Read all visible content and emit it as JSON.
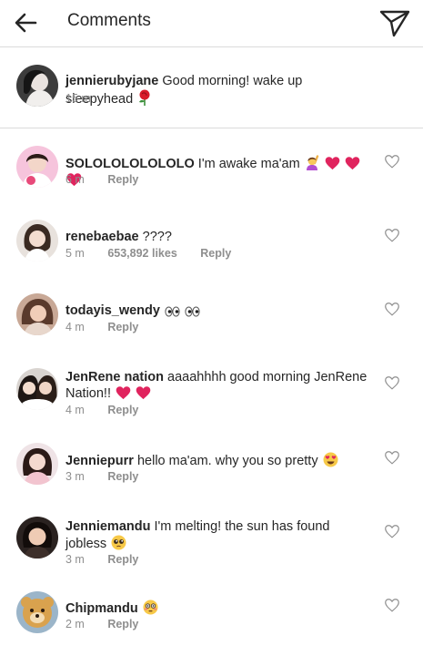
{
  "header": {
    "title": "Comments",
    "back_icon": "arrow-left-icon",
    "send_icon": "paper-plane-icon"
  },
  "caption": {
    "username": "jennierubyjane",
    "text": "Good morning! wake up sleepyhead",
    "emoji": "rose-icon",
    "time": "15 m"
  },
  "comments": [
    {
      "username": "SOLOLOLOLOLOLO",
      "text": "I'm awake ma'am",
      "emojis": [
        "raising-hand-woman-icon",
        "red-heart-icon",
        "red-heart-icon",
        "red-heart-icon"
      ],
      "time": "6 m",
      "reply": "Reply"
    },
    {
      "username": "renebaebae",
      "text": "????",
      "time": "5 m",
      "likes": "653,892 likes",
      "reply": "Reply"
    },
    {
      "username": "todayis_wendy",
      "text": "",
      "emojis": [
        "eyes-icon",
        "eyes-icon"
      ],
      "time": "4 m",
      "reply": "Reply"
    },
    {
      "username": "JenRene nation",
      "text": "aaaahhhh good morning JenRene Nation!!",
      "emojis": [
        "red-heart-icon",
        "red-heart-icon"
      ],
      "time": "4 m",
      "reply": "Reply"
    },
    {
      "username": "Jenniepurr",
      "text": "hello ma'am. why you so pretty",
      "emojis": [
        "heart-eyes-icon"
      ],
      "time": "3 m",
      "reply": "Reply"
    },
    {
      "username": "Jenniemandu",
      "text": "I'm melting! the sun has found jobless",
      "emojis": [
        "pleading-face-icon"
      ],
      "time": "3 m",
      "reply": "Reply"
    },
    {
      "username": "Chipmandu",
      "text": "",
      "emojis": [
        "flushed-face-icon"
      ],
      "time": "2 m",
      "reply": "Reply"
    }
  ],
  "colors": {
    "text": "#262626",
    "secondary": "#8e8e8e",
    "divider": "#dbdbdb",
    "heart": "#e0245e"
  }
}
